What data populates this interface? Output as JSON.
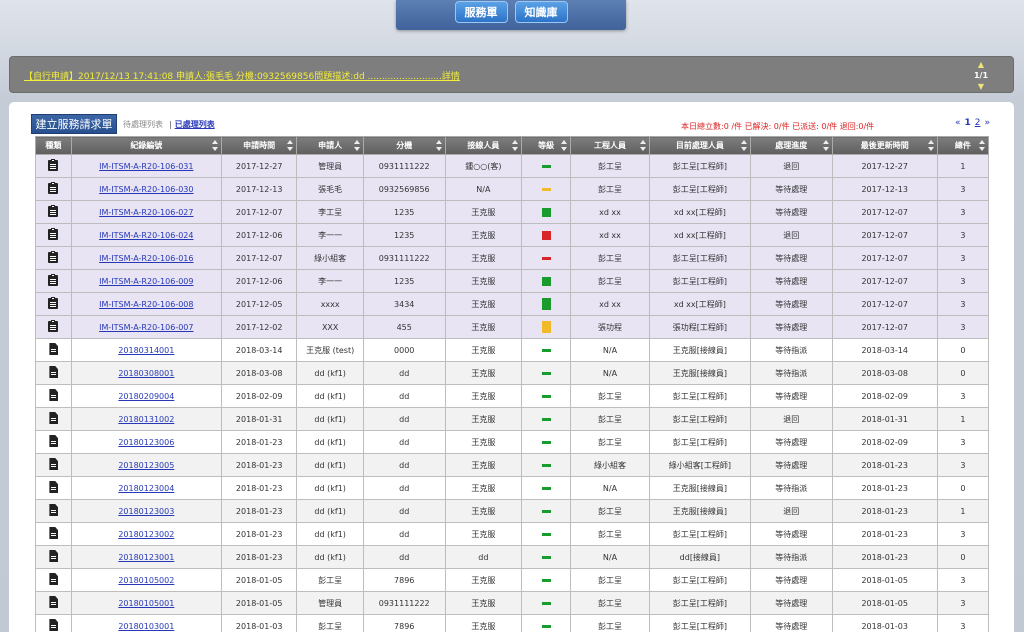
{
  "nav": {
    "service_btn": "服務單",
    "knowledge_btn": "知識庫"
  },
  "announcement": {
    "text": "【自行申請】2017/12/13 17:41:08 申請人:張毛毛 分機:0932569856問題描述:dd ..........................詳情",
    "page": "1/1"
  },
  "toolbar": {
    "new_request": "建立服務請求單",
    "tab_pending": "待處理列表",
    "tab_separator": "|",
    "tab_done": "已處理列表",
    "stats": "本日總立數:0 /件 已解決: 0/件 已派送: 0/件 退回:0/件",
    "pager": {
      "prev": "«",
      "page1": "1",
      "page2": "2",
      "next": "»"
    }
  },
  "colors": {
    "priority_green": "#1a9b2e",
    "priority_yellow": "#f2b92a",
    "priority_red": "#d8252a"
  },
  "table": {
    "headers": [
      "種類",
      "紀錄編號",
      "申請時間",
      "申請人",
      "分機",
      "接線人員",
      "等級",
      "工程人員",
      "目前處理人員",
      "處理進度",
      "最後更新時間",
      "總件"
    ],
    "rows": [
      {
        "kind": "clipboard-icon",
        "id": "IM-ITSM-A-R20-106-031",
        "time": "2017-12-27",
        "applicant": "管理員",
        "ext": "0931111222",
        "receiver": "鍾○○(客)",
        "level": "green",
        "level_shape": "bar",
        "engineer": "彭工呈",
        "handler": "彭工呈[工程師]",
        "status": "退回",
        "updated": "2017-12-27",
        "count": "1"
      },
      {
        "kind": "clipboard-icon",
        "id": "IM-ITSM-A-R20-106-030",
        "time": "2017-12-13",
        "applicant": "張毛毛",
        "ext": "0932569856",
        "receiver": "N/A",
        "level": "yellow",
        "level_shape": "bar",
        "engineer": "彭工呈",
        "handler": "彭工呈[工程師]",
        "status": "等待處理",
        "updated": "2017-12-13",
        "count": "3"
      },
      {
        "kind": "clipboard-icon",
        "id": "IM-ITSM-A-R20-106-027",
        "time": "2017-12-07",
        "applicant": "李工呈",
        "ext": "1235",
        "receiver": "王克服",
        "level": "green",
        "level_shape": "blk",
        "engineer": "xd xx",
        "handler": "xd xx[工程師]",
        "status": "等待處理",
        "updated": "2017-12-07",
        "count": "3"
      },
      {
        "kind": "clipboard-icon",
        "id": "IM-ITSM-A-R20-106-024",
        "time": "2017-12-06",
        "applicant": "李一一",
        "ext": "1235",
        "receiver": "王克服",
        "level": "red",
        "level_shape": "blk",
        "engineer": "xd xx",
        "handler": "xd xx[工程師]",
        "status": "退回",
        "updated": "2017-12-07",
        "count": "3"
      },
      {
        "kind": "clipboard-icon",
        "id": "IM-ITSM-A-R20-106-016",
        "time": "2017-12-07",
        "applicant": "綠小組客",
        "ext": "0931111222",
        "receiver": "王克服",
        "level": "red",
        "level_shape": "bar",
        "engineer": "彭工呈",
        "handler": "彭工呈[工程師]",
        "status": "等待處理",
        "updated": "2017-12-07",
        "count": "3"
      },
      {
        "kind": "clipboard-icon",
        "id": "IM-ITSM-A-R20-106-009",
        "time": "2017-12-06",
        "applicant": "李一一",
        "ext": "1235",
        "receiver": "王克服",
        "level": "green",
        "level_shape": "blk",
        "engineer": "彭工呈",
        "handler": "彭工呈[工程師]",
        "status": "等待處理",
        "updated": "2017-12-07",
        "count": "3"
      },
      {
        "kind": "clipboard-icon",
        "id": "IM-ITSM-A-R20-106-008",
        "time": "2017-12-05",
        "applicant": "xxxx",
        "ext": "3434",
        "receiver": "王克服",
        "level": "green",
        "level_shape": "tall",
        "engineer": "xd xx",
        "handler": "xd xx[工程師]",
        "status": "等待處理",
        "updated": "2017-12-07",
        "count": "3"
      },
      {
        "kind": "clipboard-icon",
        "id": "IM-ITSM-A-R20-106-007",
        "time": "2017-12-02",
        "applicant": "XXX",
        "ext": "455",
        "receiver": "王克服",
        "level": "yellow",
        "level_shape": "tall",
        "engineer": "張功程",
        "handler": "張功程[工程師]",
        "status": "等待處理",
        "updated": "2017-12-07",
        "count": "3"
      },
      {
        "kind": "doc-icon",
        "id": "20180314001",
        "time": "2018-03-14",
        "applicant": "王克服 (test)",
        "ext": "0000",
        "receiver": "王克服",
        "level": "green",
        "level_shape": "bar",
        "engineer": "N/A",
        "handler": "王克服[接線員]",
        "status": "等待指派",
        "updated": "2018-03-14",
        "count": "0"
      },
      {
        "kind": "doc-icon",
        "id": "20180308001",
        "time": "2018-03-08",
        "applicant": "dd (kf1)",
        "ext": "dd",
        "receiver": "王克服",
        "level": "green",
        "level_shape": "bar",
        "engineer": "N/A",
        "handler": "王克服[接線員]",
        "status": "等待指派",
        "updated": "2018-03-08",
        "count": "0"
      },
      {
        "kind": "doc-icon",
        "id": "20180209004",
        "time": "2018-02-09",
        "applicant": "dd (kf1)",
        "ext": "dd",
        "receiver": "王克服",
        "level": "green",
        "level_shape": "bar",
        "engineer": "彭工呈",
        "handler": "彭工呈[工程師]",
        "status": "等待處理",
        "updated": "2018-02-09",
        "count": "3"
      },
      {
        "kind": "doc-icon",
        "id": "20180131002",
        "time": "2018-01-31",
        "applicant": "dd (kf1)",
        "ext": "dd",
        "receiver": "王克服",
        "level": "green",
        "level_shape": "bar",
        "engineer": "彭工呈",
        "handler": "彭工呈[工程師]",
        "status": "退回",
        "updated": "2018-01-31",
        "count": "1"
      },
      {
        "kind": "doc-icon",
        "id": "20180123006",
        "time": "2018-01-23",
        "applicant": "dd (kf1)",
        "ext": "dd",
        "receiver": "王克服",
        "level": "green",
        "level_shape": "bar",
        "engineer": "彭工呈",
        "handler": "彭工呈[工程師]",
        "status": "等待處理",
        "updated": "2018-02-09",
        "count": "3"
      },
      {
        "kind": "doc-icon",
        "id": "20180123005",
        "time": "2018-01-23",
        "applicant": "dd (kf1)",
        "ext": "dd",
        "receiver": "王克服",
        "level": "green",
        "level_shape": "bar",
        "engineer": "綠小組客",
        "handler": "綠小組客[工程師]",
        "status": "等待處理",
        "updated": "2018-01-23",
        "count": "3"
      },
      {
        "kind": "doc-icon",
        "id": "20180123004",
        "time": "2018-01-23",
        "applicant": "dd (kf1)",
        "ext": "dd",
        "receiver": "王克服",
        "level": "green",
        "level_shape": "bar",
        "engineer": "N/A",
        "handler": "王克服[接線員]",
        "status": "等待指派",
        "updated": "2018-01-23",
        "count": "0"
      },
      {
        "kind": "doc-icon",
        "id": "20180123003",
        "time": "2018-01-23",
        "applicant": "dd (kf1)",
        "ext": "dd",
        "receiver": "王克服",
        "level": "green",
        "level_shape": "bar",
        "engineer": "彭工呈",
        "handler": "王克服[接線員]",
        "status": "退回",
        "updated": "2018-01-23",
        "count": "1"
      },
      {
        "kind": "doc-icon",
        "id": "20180123002",
        "time": "2018-01-23",
        "applicant": "dd (kf1)",
        "ext": "dd",
        "receiver": "王克服",
        "level": "green",
        "level_shape": "bar",
        "engineer": "彭工呈",
        "handler": "彭工呈[工程師]",
        "status": "等待處理",
        "updated": "2018-01-23",
        "count": "3"
      },
      {
        "kind": "doc-icon",
        "id": "20180123001",
        "time": "2018-01-23",
        "applicant": "dd (kf1)",
        "ext": "dd",
        "receiver": "dd",
        "level": "green",
        "level_shape": "bar",
        "engineer": "N/A",
        "handler": "dd[接線員]",
        "status": "等待指派",
        "updated": "2018-01-23",
        "count": "0"
      },
      {
        "kind": "doc-icon",
        "id": "20180105002",
        "time": "2018-01-05",
        "applicant": "彭工呈",
        "ext": "7896",
        "receiver": "王克服",
        "level": "green",
        "level_shape": "bar",
        "engineer": "彭工呈",
        "handler": "彭工呈[工程師]",
        "status": "等待處理",
        "updated": "2018-01-05",
        "count": "3"
      },
      {
        "kind": "doc-icon",
        "id": "20180105001",
        "time": "2018-01-05",
        "applicant": "管理員",
        "ext": "0931111222",
        "receiver": "王克服",
        "level": "green",
        "level_shape": "bar",
        "engineer": "彭工呈",
        "handler": "彭工呈[工程師]",
        "status": "等待處理",
        "updated": "2018-01-05",
        "count": "3"
      },
      {
        "kind": "doc-icon",
        "id": "20180103001",
        "time": "2018-01-03",
        "applicant": "彭工呈",
        "ext": "7896",
        "receiver": "王克服",
        "level": "green",
        "level_shape": "bar",
        "engineer": "彭工呈",
        "handler": "彭工呈[工程師]",
        "status": "等待處理",
        "updated": "2018-01-03",
        "count": "3"
      }
    ]
  }
}
